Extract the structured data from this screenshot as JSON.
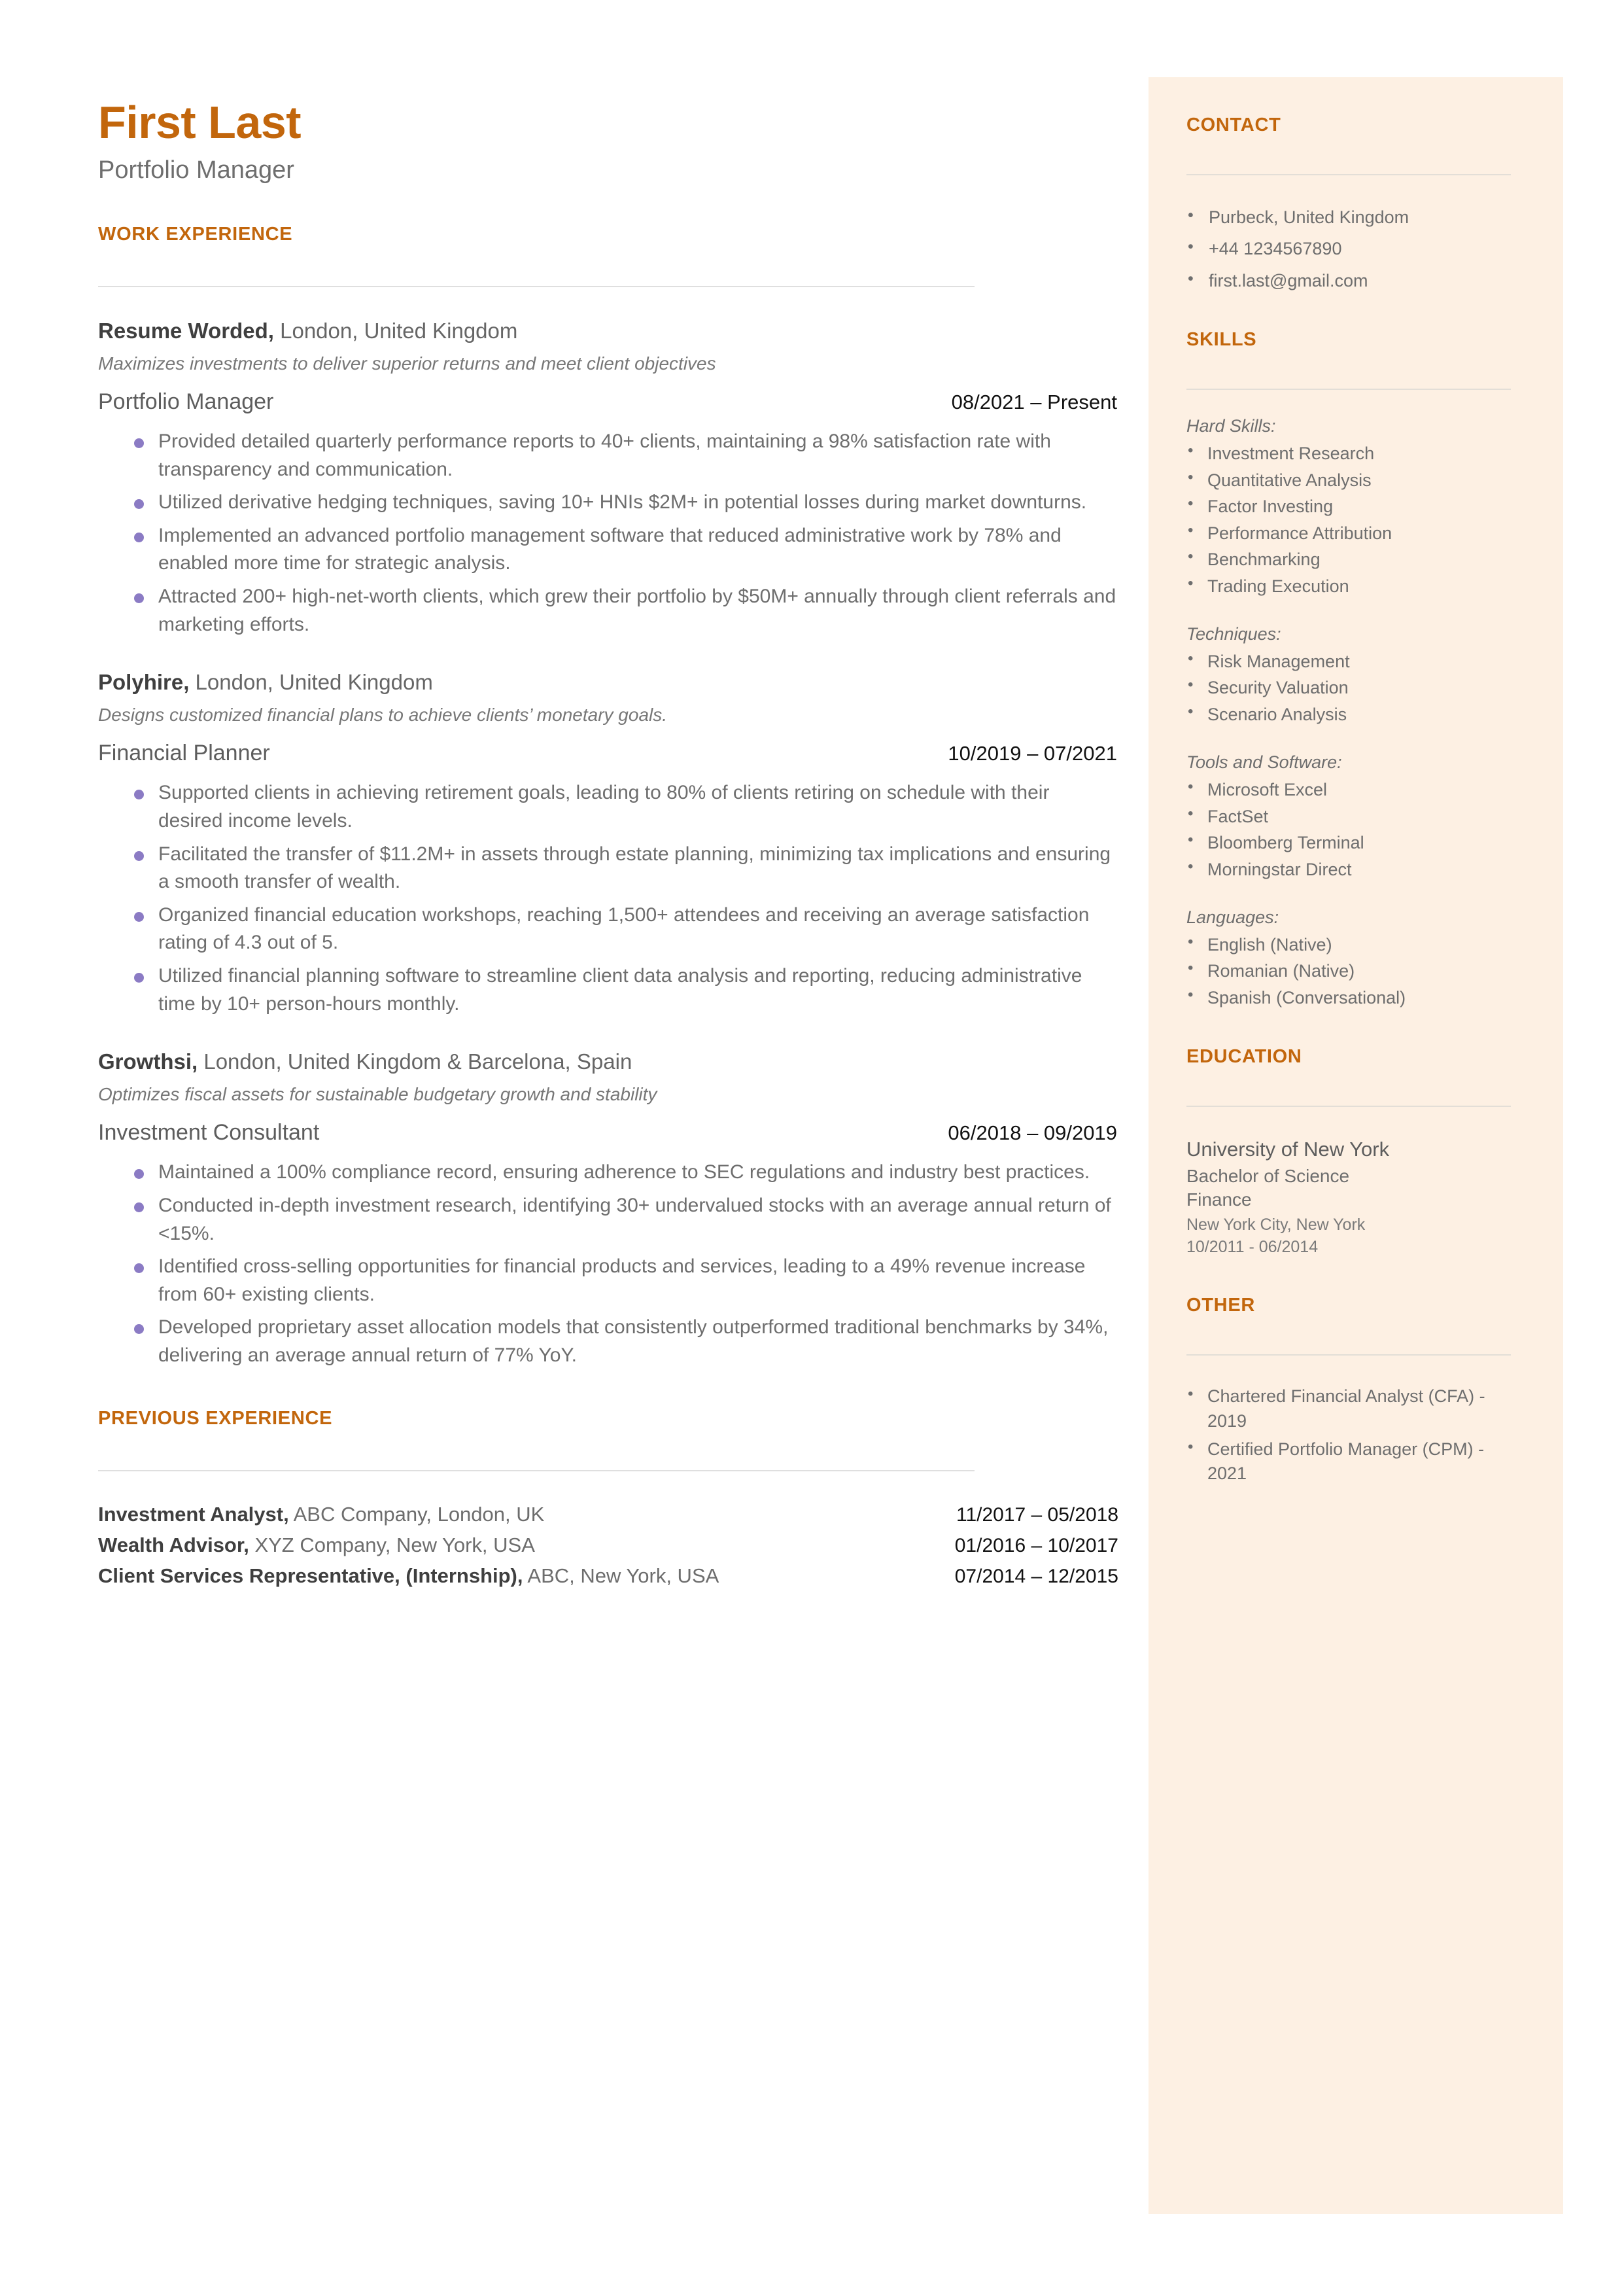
{
  "colors": {
    "accent": "#C2660C",
    "sidebar_bg": "#FDF0E3",
    "bullet": "#8B7BC4",
    "body_text": "#6e6e6e",
    "rule": "#dfdfdf"
  },
  "header": {
    "name": "First Last",
    "role": "Portfolio Manager"
  },
  "work_experience": {
    "heading": "WORK EXPERIENCE",
    "jobs": [
      {
        "company_name": "Resume Worded,",
        "company_location": " London, United Kingdom",
        "company_desc": "Maximizes investments to deliver superior returns and meet client objectives",
        "title": "Portfolio Manager",
        "dates": "08/2021 – Present",
        "bullets": [
          "Provided detailed quarterly performance reports to 40+ clients, maintaining a 98% satisfaction rate with transparency and communication.",
          "Utilized derivative hedging techniques, saving 10+ HNIs $2M+ in potential losses during market downturns.",
          "Implemented an advanced portfolio management software that reduced administrative work by 78% and enabled more time for strategic analysis.",
          "Attracted 200+ high-net-worth clients, which grew their portfolio by $50M+ annually through client referrals and marketing efforts."
        ]
      },
      {
        "company_name": "Polyhire,",
        "company_location": " London, United Kingdom",
        "company_desc": "Designs customized financial plans to achieve clients’ monetary goals.",
        "title": "Financial Planner",
        "dates": "10/2019 – 07/2021",
        "bullets": [
          "Supported clients in achieving retirement goals, leading to 80% of clients retiring on schedule with their desired income levels.",
          "Facilitated the transfer of $11.2M+ in assets through estate planning, minimizing tax implications and ensuring a smooth transfer of wealth.",
          "Organized financial education workshops, reaching 1,500+ attendees and receiving an average satisfaction rating of 4.3 out of 5.",
          "Utilized financial planning software to streamline client data analysis and reporting, reducing administrative time by 10+ person-hours monthly."
        ]
      },
      {
        "company_name": "Growthsi,",
        "company_location": " London, United Kingdom & Barcelona, Spain",
        "company_desc": "Optimizes fiscal assets for sustainable budgetary growth and stability",
        "title": "Investment Consultant",
        "dates": "06/2018 – 09/2019",
        "bullets": [
          "Maintained a 100% compliance record, ensuring adherence to SEC regulations and industry best practices.",
          "Conducted in-depth investment research, identifying 30+ undervalued stocks with an average annual return of <15%.",
          "Identified cross-selling opportunities for financial products and services, leading to a 49% revenue increase from 60+ existing clients.",
          "Developed proprietary asset allocation models that consistently outperformed traditional benchmarks by 34%, delivering an average annual return of 77% YoY."
        ]
      }
    ]
  },
  "previous_experience": {
    "heading": "PREVIOUS EXPERIENCE",
    "rows": [
      {
        "title": "Investment Analyst,",
        "detail": " ABC Company, London, UK",
        "dates": "11/2017 – 05/2018"
      },
      {
        "title": "Wealth Advisor,",
        "detail": " XYZ Company, New York, USA",
        "dates": "01/2016 – 10/2017"
      },
      {
        "title": "Client Services Representative, (Internship),",
        "detail": " ABC, New York, USA",
        "dates": "07/2014 – 12/2015"
      }
    ]
  },
  "sidebar": {
    "contact": {
      "heading": "CONTACT",
      "items": [
        "Purbeck, United Kingdom",
        "+44 1234567890",
        "first.last@gmail.com"
      ]
    },
    "skills": {
      "heading": "SKILLS",
      "groups": [
        {
          "label": "Hard Skills:",
          "items": [
            "Investment Research",
            "Quantitative Analysis",
            "Factor Investing",
            "Performance Attribution",
            "Benchmarking",
            "Trading Execution"
          ]
        },
        {
          "label": "Techniques:",
          "items": [
            "Risk Management",
            "Security Valuation",
            "Scenario Analysis"
          ]
        },
        {
          "label": "Tools and Software:",
          "items": [
            "Microsoft Excel",
            "FactSet",
            "Bloomberg Terminal",
            "Morningstar Direct"
          ]
        },
        {
          "label": "Languages:",
          "items": [
            "English (Native)",
            "Romanian (Native)",
            "Spanish (Conversational)"
          ]
        }
      ]
    },
    "education": {
      "heading": "EDUCATION",
      "school": "University of New York",
      "degree": "Bachelor of Science",
      "field": "Finance",
      "location": "New York City, New York",
      "dates": "10/2011 - 06/2014"
    },
    "other": {
      "heading": "OTHER",
      "items": [
        "Chartered Financial Analyst (CFA) - 2019",
        "Certified Portfolio Manager (CPM) - 2021"
      ]
    }
  }
}
